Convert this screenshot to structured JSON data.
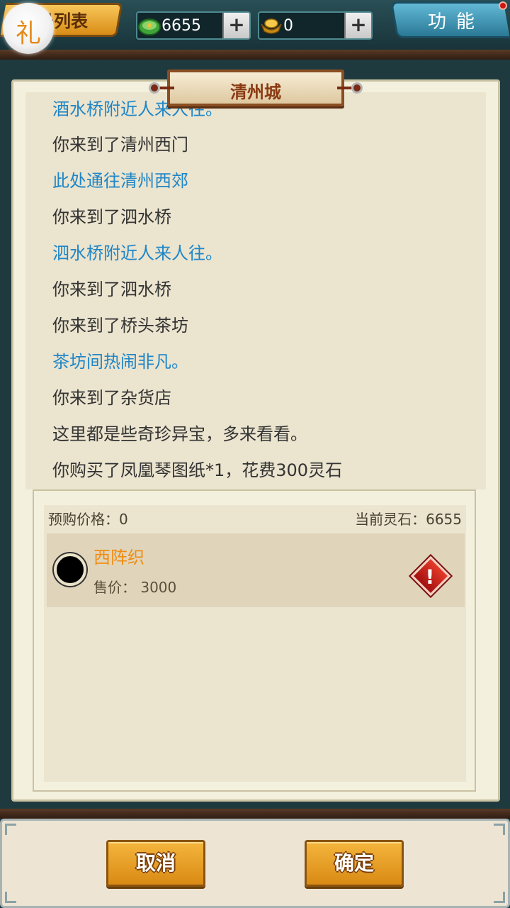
{
  "topbar": {
    "list_label": "号列表",
    "gift_glyph": "礼",
    "jade": {
      "value": "6655",
      "plus": "+",
      "icon": "jade-coin-icon",
      "color": "#3fa53a"
    },
    "gold": {
      "value": "0",
      "plus": "+",
      "icon": "gold-ingot-icon",
      "color": "#e6a620"
    },
    "function_label": "功能"
  },
  "location": {
    "title": "清州城"
  },
  "log": {
    "lines": [
      {
        "text": "酒水桥附近人来人往。",
        "type": "event"
      },
      {
        "text": "你来到了清州西门",
        "type": "normal"
      },
      {
        "text": "此处通往清州西郊",
        "type": "event"
      },
      {
        "text": "你来到了泗水桥",
        "type": "normal"
      },
      {
        "text": "泗水桥附近人来人往。",
        "type": "event"
      },
      {
        "text": "你来到了泗水桥",
        "type": "normal"
      },
      {
        "text": "你来到了桥头茶坊",
        "type": "normal"
      },
      {
        "text": "茶坊间热闹非凡。",
        "type": "event"
      },
      {
        "text": "你来到了杂货店",
        "type": "normal"
      },
      {
        "text": "这里都是些奇珍异宝，多来看看。",
        "type": "normal"
      },
      {
        "text": "你购买了凤凰琴图纸*1，花费300灵石",
        "type": "normal"
      }
    ]
  },
  "shop": {
    "pre_price": "预购价格：0",
    "current_stone": "当前灵石：6655",
    "items": [
      {
        "name": "西阵织",
        "price_label": "售价：",
        "price": "3000",
        "warn_glyph": "!"
      }
    ]
  },
  "actions": {
    "cancel": "取消",
    "confirm": "确定"
  },
  "colors": {
    "event_text": "#1f86c7",
    "normal_text": "#333333",
    "item_name": "#f08c10",
    "button": "#e8a12a"
  }
}
